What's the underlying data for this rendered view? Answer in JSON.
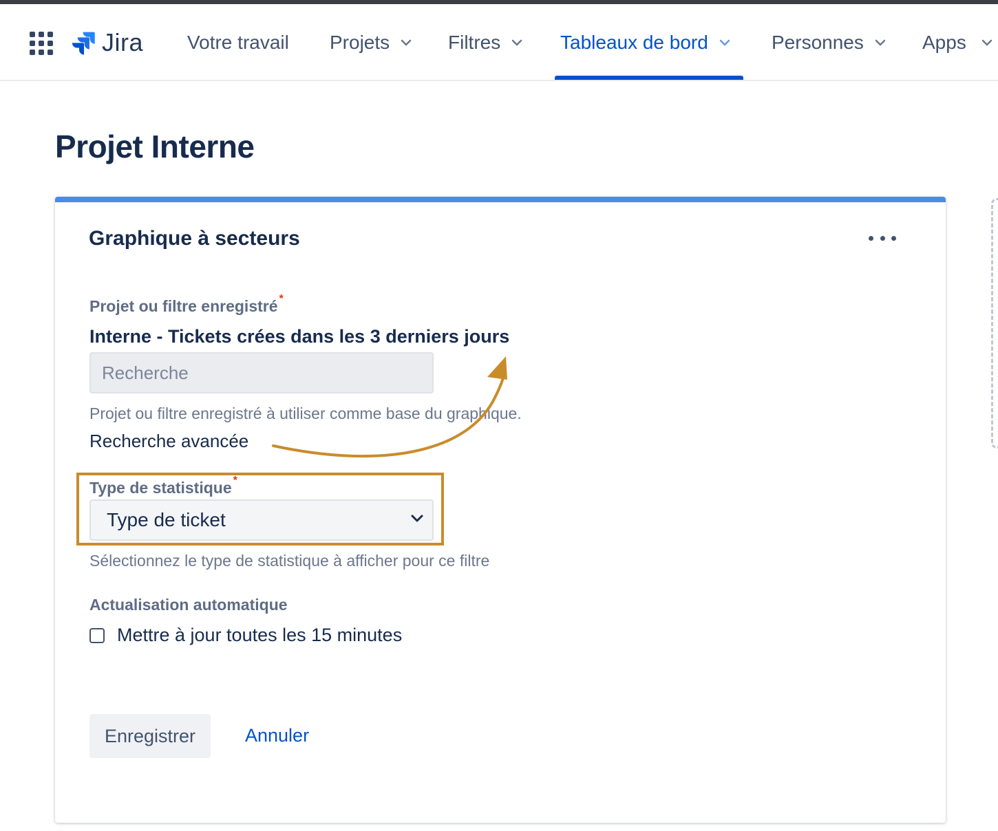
{
  "app": {
    "logo_text": "Jira"
  },
  "nav": {
    "items": [
      {
        "label": "Votre travail",
        "has_chevron": false
      },
      {
        "label": "Projets",
        "has_chevron": true
      },
      {
        "label": "Filtres",
        "has_chevron": true
      },
      {
        "label": "Tableaux de bord",
        "has_chevron": true,
        "active": true
      },
      {
        "label": "Personnes",
        "has_chevron": true
      },
      {
        "label": "Apps",
        "has_chevron": true
      }
    ]
  },
  "page": {
    "title": "Projet Interne"
  },
  "gadget": {
    "title": "Graphique à secteurs",
    "project_field": {
      "label": "Projet ou filtre enregistré",
      "required_mark": "*",
      "selected_value": "Interne - Tickets crées dans les 3 derniers jours",
      "search_placeholder": "Recherche",
      "help_text": "Projet ou filtre enregistré à utiliser comme base du graphique.",
      "advanced_link": "Recherche avancée"
    },
    "statistic_field": {
      "label": "Type de statistique",
      "required_mark": "*",
      "selected_value": "Type de ticket",
      "help_text": "Sélectionnez le type de statistique à afficher pour ce filtre"
    },
    "refresh_field": {
      "label": "Actualisation automatique",
      "checkbox_label": "Mettre à jour toutes les 15 minutes",
      "checked": false
    },
    "actions": {
      "save": "Enregistrer",
      "cancel": "Annuler"
    }
  },
  "icons": {
    "app_switcher": "grid-icon",
    "logo": "jira-logo-icon",
    "nav_chevron": "chevron-down-icon",
    "more": "more-horizontal-icon",
    "select_chevron": "chevron-down-icon"
  },
  "colors": {
    "accent": "#0052cc",
    "card_top_bar": "#4c8ae8",
    "annotation": "#c98c2b",
    "required": "#de350b"
  }
}
